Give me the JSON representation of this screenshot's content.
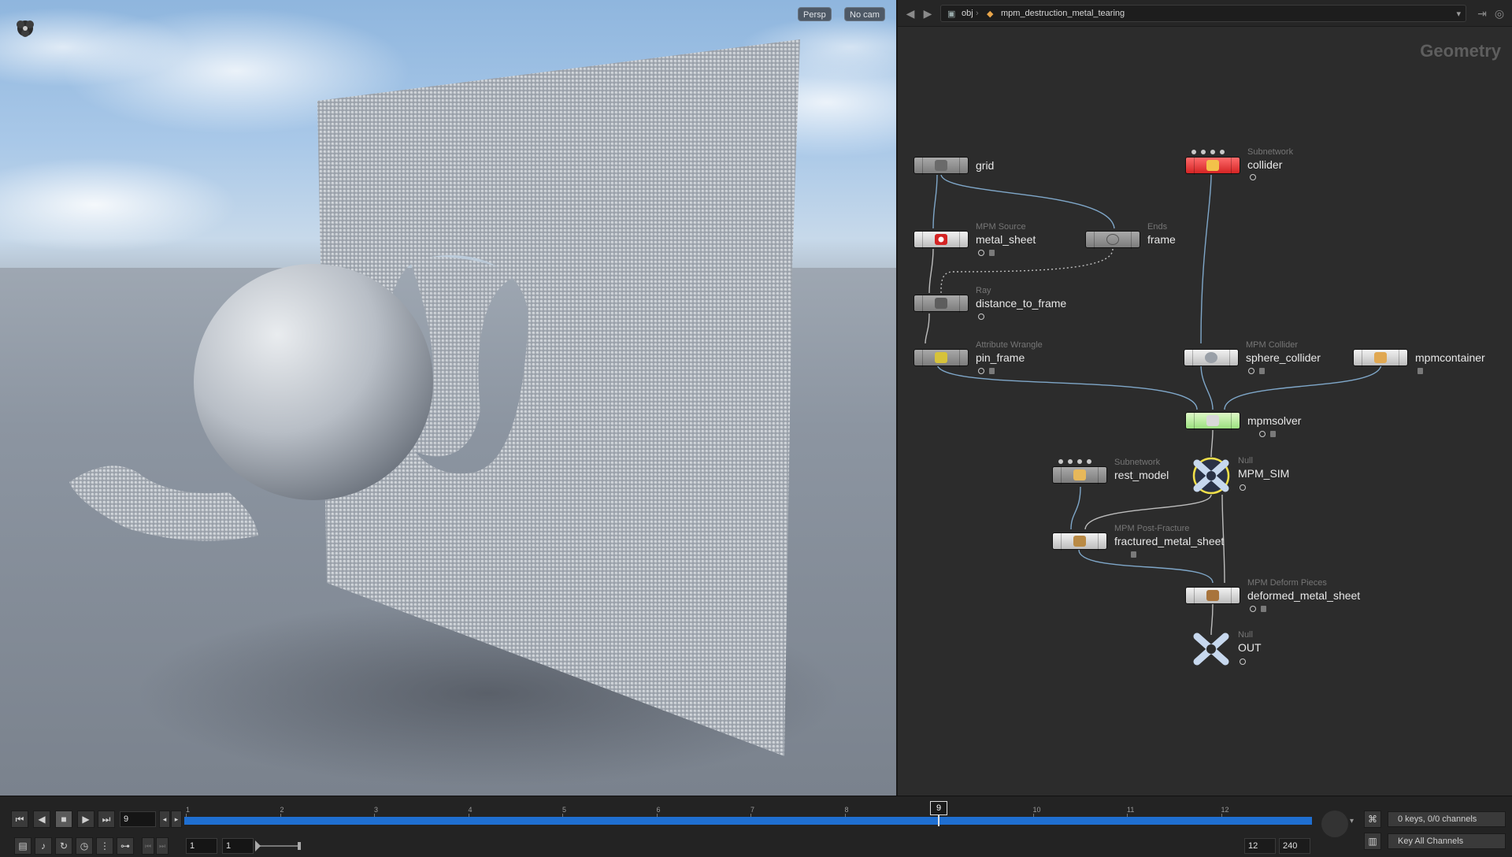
{
  "viewport": {
    "persp_label": "Persp",
    "cam_label": "No cam"
  },
  "path_bar": {
    "root": "obj",
    "network": "mpm_destruction_metal_tearing"
  },
  "network_context": "Geometry",
  "nodes": {
    "grid": {
      "type": "",
      "name": "grid"
    },
    "collider": {
      "type": "Subnetwork",
      "name": "collider"
    },
    "metal_sheet": {
      "type": "MPM Source",
      "name": "metal_sheet"
    },
    "frame": {
      "type": "Ends",
      "name": "frame"
    },
    "distance_to_frame": {
      "type": "Ray",
      "name": "distance_to_frame"
    },
    "pin_frame": {
      "type": "Attribute Wrangle",
      "name": "pin_frame"
    },
    "sphere_collider": {
      "type": "MPM Collider",
      "name": "sphere_collider"
    },
    "mpmcontainer": {
      "type": "",
      "name": "mpmcontainer"
    },
    "mpmsolver": {
      "type": "",
      "name": "mpmsolver"
    },
    "rest_model": {
      "type": "Subnetwork",
      "name": "rest_model"
    },
    "mpm_sim": {
      "type": "Null",
      "name": "MPM_SIM"
    },
    "fractured_metal_sheet": {
      "type": "MPM Post-Fracture",
      "name": "fractured_metal_sheet"
    },
    "deformed_metal_sheet": {
      "type": "MPM Deform Pieces",
      "name": "deformed_metal_sheet"
    },
    "out": {
      "type": "Null",
      "name": "OUT"
    }
  },
  "timeline": {
    "current_frame": "9",
    "ticks": [
      "1",
      "2",
      "3",
      "4",
      "5",
      "6",
      "7",
      "8",
      "9",
      "10",
      "11",
      "12"
    ],
    "playhead_label": "9",
    "start_frame": "1",
    "range_start": "1",
    "range_end": "12",
    "end_frame": "240",
    "keys_label": "0 keys, 0/0 channels",
    "key_all_label": "Key All Channels"
  },
  "colors": {
    "timeline_bar": "#1f6fd1",
    "collider_node": "#e03030",
    "solver_node": "#b6ec9a"
  }
}
